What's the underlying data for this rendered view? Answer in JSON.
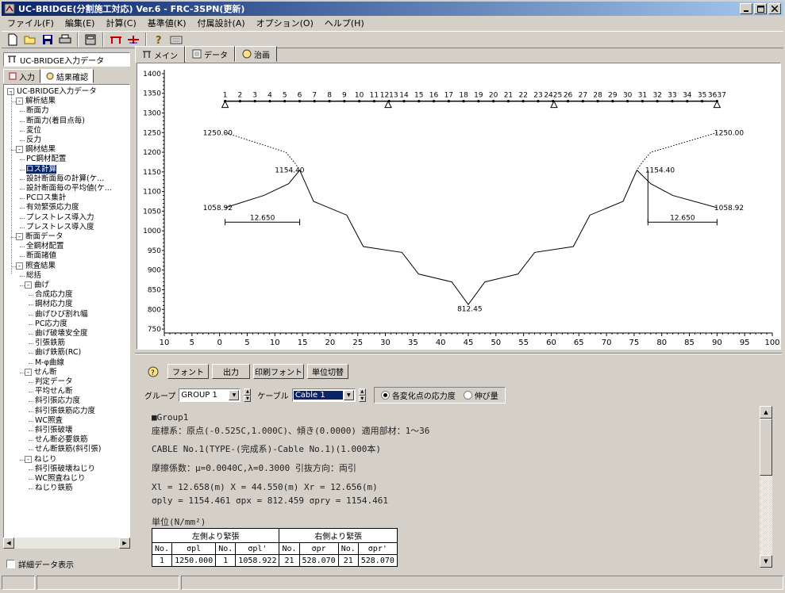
{
  "window": {
    "title": "UC-BRIDGE(分割施工対応) Ver.6 - FRC-3SPN(更新)"
  },
  "menu": [
    "ファイル(F)",
    "編集(E)",
    "計算(C)",
    "基準値(K)",
    "付属設計(A)",
    "オプション(O)",
    "ヘルプ(H)"
  ],
  "left_panel": {
    "header": "UC-BRIDGE入力データ",
    "tabs": [
      "入力",
      "結果確認"
    ],
    "tree": [
      {
        "label": "UC-BRIDGE入力データ",
        "level": 0,
        "box": "-"
      },
      {
        "label": "解析結果",
        "level": 1,
        "box": "-"
      },
      {
        "label": "断面力",
        "level": 2
      },
      {
        "label": "断面力(着目点毎)",
        "level": 2
      },
      {
        "label": "変位",
        "level": 2
      },
      {
        "label": "反力",
        "level": 2
      },
      {
        "label": "鋼材結果",
        "level": 1,
        "box": "-"
      },
      {
        "label": "PC鋼材配置",
        "level": 2
      },
      {
        "label": "ロス計算",
        "level": 2,
        "selected": true
      },
      {
        "label": "設計断面毎の計算(ケ...",
        "level": 2
      },
      {
        "label": "設計断面毎の平均値(ケ...",
        "level": 2
      },
      {
        "label": "PCロス集計",
        "level": 2
      },
      {
        "label": "有効緊張応力度",
        "level": 2
      },
      {
        "label": "プレストレス導入力",
        "level": 2
      },
      {
        "label": "プレストレス導入度",
        "level": 2
      },
      {
        "label": "断面データ",
        "level": 1,
        "box": "-"
      },
      {
        "label": "全鋼材配置",
        "level": 2
      },
      {
        "label": "断面諸値",
        "level": 2
      },
      {
        "label": "照査結果",
        "level": 1,
        "box": "-"
      },
      {
        "label": "総括",
        "level": 2
      },
      {
        "label": "曲げ",
        "level": 2,
        "box": "-"
      },
      {
        "label": "合成応力度",
        "level": 3
      },
      {
        "label": "鋼材応力度",
        "level": 3
      },
      {
        "label": "曲げひび割れ幅",
        "level": 3
      },
      {
        "label": "PC応力度",
        "level": 3
      },
      {
        "label": "曲げ破壊安全度",
        "level": 3
      },
      {
        "label": "引張鉄筋",
        "level": 3
      },
      {
        "label": "曲げ鉄筋(RC)",
        "level": 3
      },
      {
        "label": "M-φ曲線",
        "level": 3
      },
      {
        "label": "せん断",
        "level": 2,
        "box": "-"
      },
      {
        "label": "判定データ",
        "level": 3
      },
      {
        "label": "平均せん断",
        "level": 3
      },
      {
        "label": "斜引張応力度",
        "level": 3
      },
      {
        "label": "斜引張鉄筋応力度",
        "level": 3
      },
      {
        "label": "WC照査",
        "level": 3
      },
      {
        "label": "斜引張破壊",
        "level": 3
      },
      {
        "label": "せん断必要鉄筋",
        "level": 3
      },
      {
        "label": "せん断鉄筋(斜引張)",
        "level": 3
      },
      {
        "label": "ねじり",
        "level": 2,
        "box": "-"
      },
      {
        "label": "斜引張破壊ねじり",
        "level": 3
      },
      {
        "label": "WC照査ねじり",
        "level": 3
      },
      {
        "label": "ねじり鉄筋",
        "level": 3
      }
    ],
    "detail_checkbox": "詳細データ表示"
  },
  "right_tabs": [
    "メイン",
    "データ",
    "治画"
  ],
  "chart_data": {
    "type": "line",
    "x_ticks": [
      10,
      5,
      0,
      5,
      10,
      15,
      20,
      25,
      30,
      35,
      40,
      45,
      50,
      55,
      60,
      65,
      70,
      75,
      80,
      85,
      90,
      95,
      100
    ],
    "y_ticks": [
      1400,
      1350,
      1300,
      1250,
      1200,
      1150,
      1100,
      1050,
      1000,
      950,
      900,
      850,
      800,
      750
    ],
    "xlim": [
      -10,
      100
    ],
    "ylim": [
      740,
      1410
    ],
    "beam_y": 1330,
    "node_labels": [
      "1",
      "2",
      "3",
      "4",
      "5",
      "6",
      "7",
      "8",
      "9",
      "10",
      "11",
      "1213",
      "14",
      "15",
      "16",
      "17",
      "18",
      "19",
      "20",
      "21",
      "22",
      "23",
      "2425",
      "26",
      "27",
      "28",
      "29",
      "30",
      "31",
      "32",
      "33",
      "34",
      "35",
      "3637"
    ],
    "supports_x": [
      1.0,
      30.5,
      60.5,
      90.0
    ],
    "cable": [
      [
        1.0,
        1058.92
      ],
      [
        8,
        1090
      ],
      [
        12.5,
        1120
      ],
      [
        14.5,
        1154.4
      ],
      [
        17,
        1075
      ],
      [
        23,
        1040
      ],
      [
        26,
        960
      ],
      [
        33,
        945
      ],
      [
        36,
        890
      ],
      [
        42,
        870
      ],
      [
        45,
        812.45
      ],
      [
        48,
        870
      ],
      [
        54,
        890
      ],
      [
        57,
        945
      ],
      [
        64,
        960
      ],
      [
        67,
        1040
      ],
      [
        73,
        1075
      ],
      [
        75.5,
        1154.4
      ],
      [
        78,
        1120
      ],
      [
        82,
        1090
      ],
      [
        90.0,
        1058.92
      ]
    ],
    "dotted_left": [
      [
        1.0,
        1250.0
      ],
      [
        12,
        1200
      ],
      [
        13.5,
        1175
      ],
      [
        14.5,
        1154.4
      ]
    ],
    "dotted_right": [
      [
        90.0,
        1250.0
      ],
      [
        78,
        1200
      ],
      [
        76.5,
        1175
      ],
      [
        75.5,
        1154.4
      ]
    ],
    "labels": [
      {
        "text": "1250.00",
        "x": -3,
        "y": 1250,
        "anchor": "start"
      },
      {
        "text": "1154.40",
        "x": 10.0,
        "y": 1154.4,
        "anchor": "start"
      },
      {
        "text": "1058.92",
        "x": -3,
        "y": 1058.92,
        "anchor": "start"
      },
      {
        "text": "812.45",
        "x": 43.0,
        "y": 802,
        "anchor": "start"
      },
      {
        "text": "1250.00",
        "x": 89.5,
        "y": 1250,
        "anchor": "start"
      },
      {
        "text": "1154.40",
        "x": 77.0,
        "y": 1154.4,
        "anchor": "start"
      },
      {
        "text": "1058.92",
        "x": 89.5,
        "y": 1058.92,
        "anchor": "start"
      }
    ],
    "dim_left": {
      "x1": 1.0,
      "x2": 14.5,
      "y": 1022,
      "text": "12.650"
    },
    "dim_right": {
      "x1": 77.5,
      "x2": 90.0,
      "y": 1022,
      "text": "12.650"
    }
  },
  "buttons": [
    "フォント",
    "出力",
    "印刷フォント",
    "単位切替"
  ],
  "selectors": {
    "group_label": "グループ",
    "group_value": "GROUP 1",
    "cable_label": "ケーブル",
    "cable_value": "Cable 1",
    "radio": [
      {
        "label": "各変化点の応力度",
        "checked": true
      },
      {
        "label": "伸び量",
        "checked": false
      }
    ]
  },
  "report": {
    "lines": [
      "■Group1",
      "座標系：原点(-0.525C,1.000C)、傾き(0.0000) 適用部材：1～36",
      "CABLE No.1(TYPE-(完成系)-Cable No.1)(1.000本)",
      "摩擦係数：μ=0.0040C,λ=0.3000  引抜方向：両引",
      "   Xl = 12.658(m)    X = 44.550(m)    Xr = 12.656(m)",
      "  σply = 1154.461   σpx = 812.459   σpry = 1154.461",
      "単位(N/mm²)"
    ],
    "table": {
      "group_headers": [
        "左側より緊張",
        "右側より緊張"
      ],
      "col_headers": [
        "No.",
        "σpl",
        "No.",
        "σpl'",
        "No.",
        "σpr",
        "No.",
        "σpr'"
      ],
      "rows": [
        [
          "1",
          "1250.000",
          "1",
          "1058.922",
          "21",
          "528.070",
          "21",
          "528.070"
        ]
      ]
    }
  }
}
